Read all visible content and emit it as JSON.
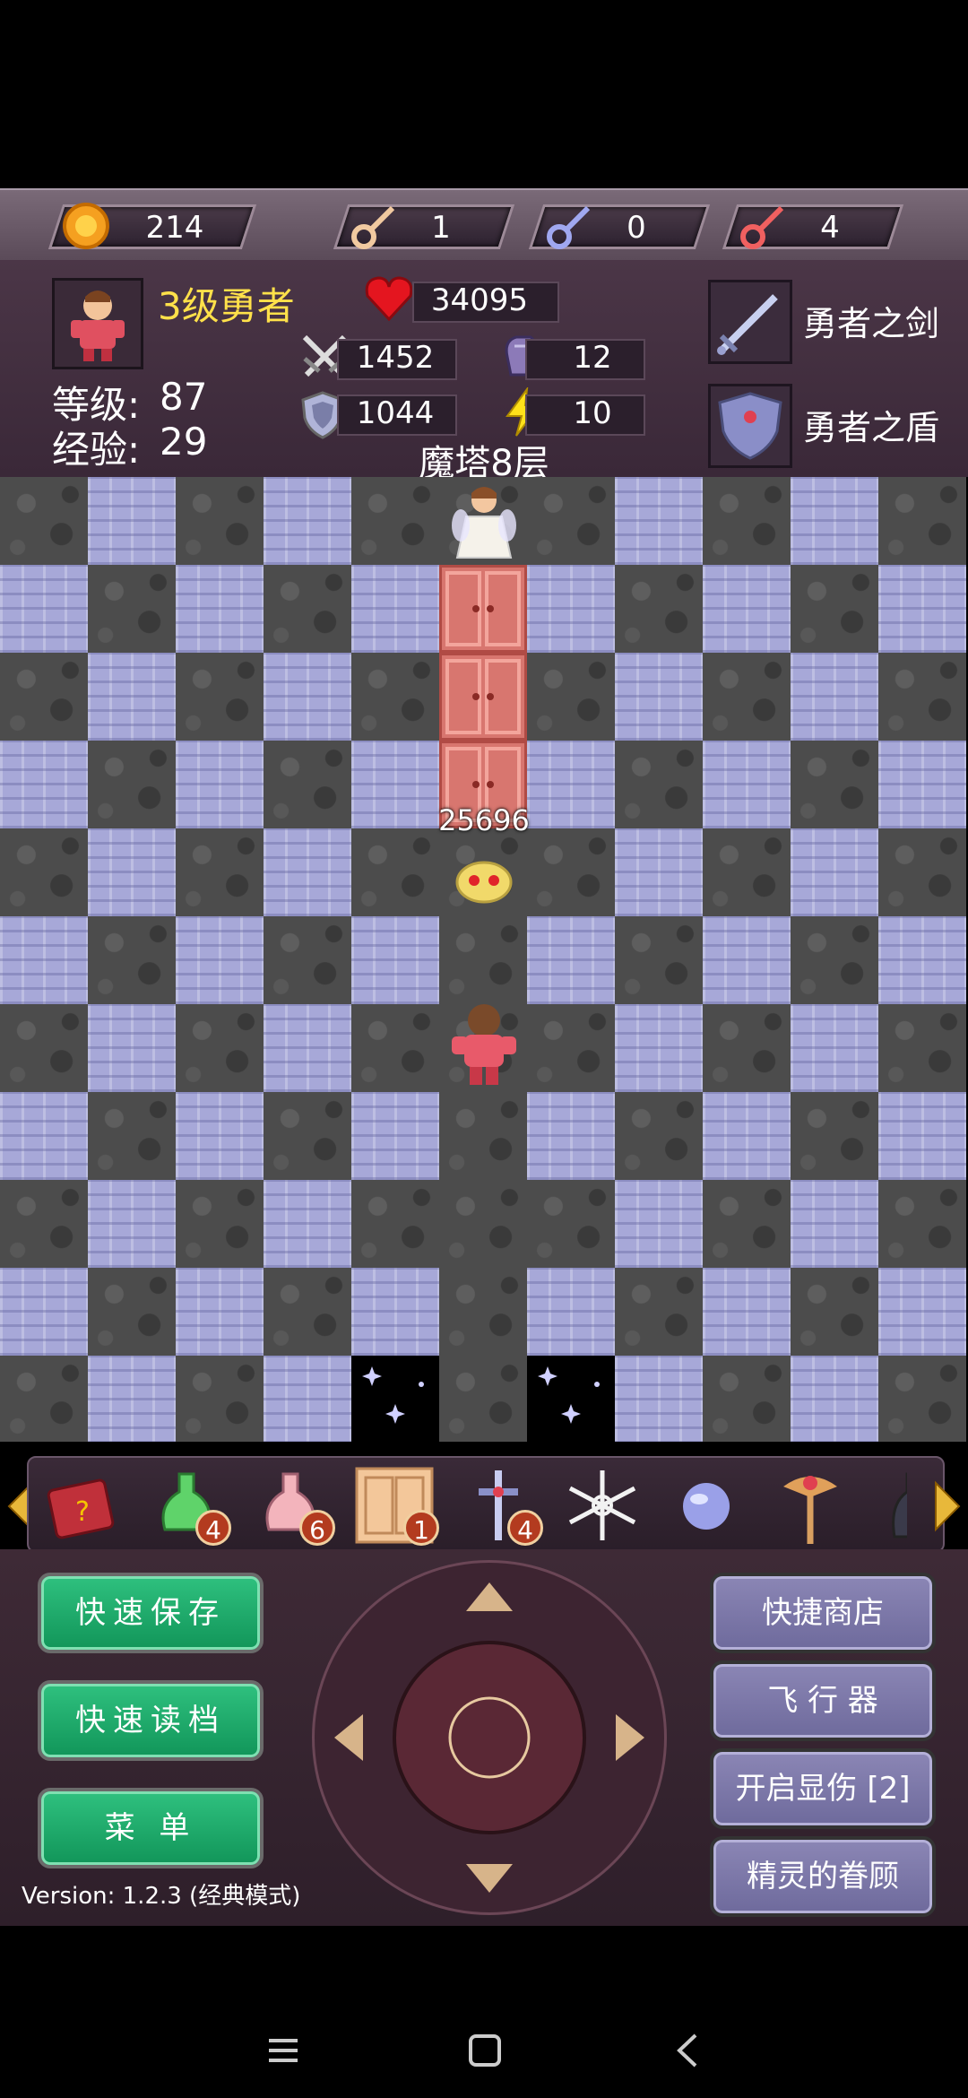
{
  "resources": {
    "gold": "214",
    "yellow_keys": "1",
    "blue_keys": "0",
    "red_keys": "4"
  },
  "hero": {
    "title": "3级勇者",
    "level_label": "等级:",
    "level": "87",
    "exp_label": "经验:",
    "exp": "29",
    "hp": "34095",
    "attack": "1452",
    "defense": "1044",
    "magic_defense": "12",
    "speed": "10"
  },
  "equipment": {
    "weapon": "勇者之剑",
    "shield": "勇者之盾"
  },
  "floor_label": "魔塔8层",
  "map": {
    "monster_damage": "25696"
  },
  "items": [
    {
      "icon": "monster-manual-book-icon",
      "count": ""
    },
    {
      "icon": "green-potion-icon",
      "count": "4"
    },
    {
      "icon": "pink-potion-icon",
      "count": "6"
    },
    {
      "icon": "door-scroll-icon",
      "count": "1"
    },
    {
      "icon": "cross-sword-icon",
      "count": "4"
    },
    {
      "icon": "snowflake-icon",
      "count": ""
    },
    {
      "icon": "orb-icon",
      "count": ""
    },
    {
      "icon": "staff-icon",
      "count": ""
    },
    {
      "icon": "bottle-icon",
      "count": ""
    }
  ],
  "buttons": {
    "quick_save": "快速保存",
    "quick_load": "快速读档",
    "menu": "菜 单",
    "quick_shop": "快捷商店",
    "flyer": "飞 行 器",
    "show_damage": "开启显伤 [2]",
    "fairy_favor": "精灵的眷顾"
  },
  "version": "Version: 1.2.3 (经典模式)",
  "colors": {
    "accent_yellow": "#ffe14a",
    "green_button": "#1aa86a",
    "purple_button": "#7c78a9"
  }
}
